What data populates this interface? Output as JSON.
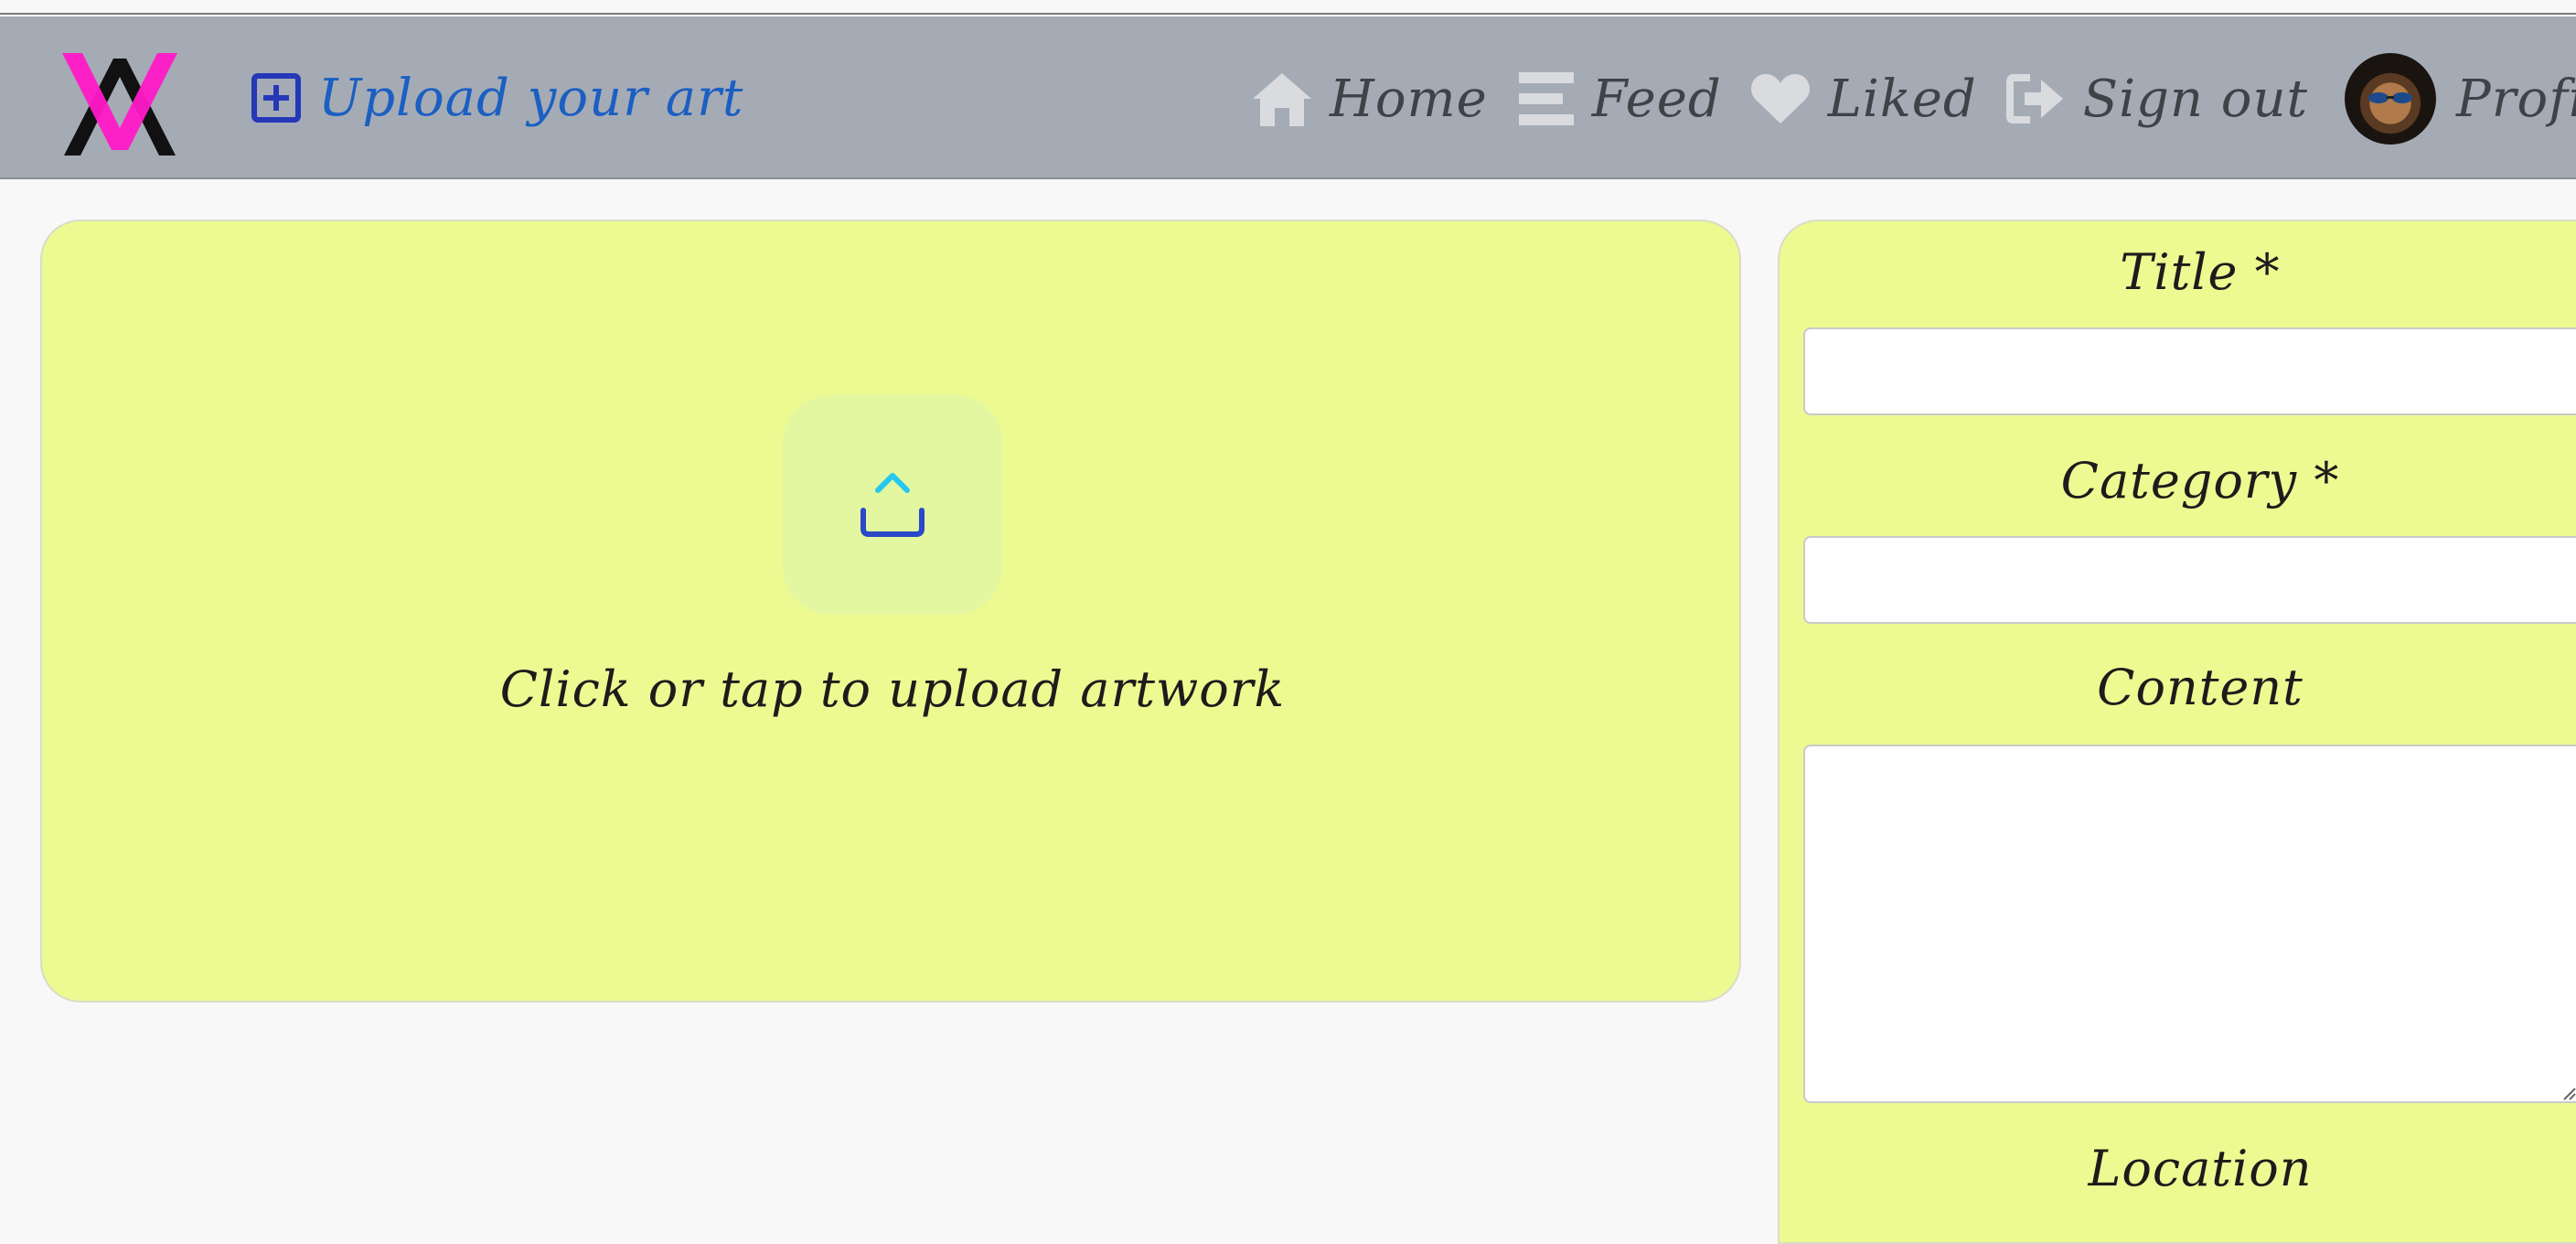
{
  "navbar": {
    "upload_label": "Upload your art",
    "items": [
      {
        "label": "Home",
        "icon": "home-icon"
      },
      {
        "label": "Feed",
        "icon": "bars-icon"
      },
      {
        "label": "Liked",
        "icon": "heart-icon"
      },
      {
        "label": "Sign out",
        "icon": "sign-out-icon"
      },
      {
        "label": "Profile",
        "icon": "avatar"
      }
    ]
  },
  "upload_area": {
    "prompt": "Click or tap to upload artwork",
    "icon": "upload-icon"
  },
  "form": {
    "title_label": "Title *",
    "title_value": "",
    "category_label": "Category *",
    "category_value": "",
    "content_label": "Content",
    "content_value": "",
    "location_label": "Location"
  },
  "colors": {
    "navbar_bg": "#a5abb5",
    "card_bg": "#edfa91",
    "upload_link": "#1b5fc2",
    "logo_magenta": "#ff19c8",
    "logo_black": "#111111",
    "nav_icon": "#d9dbdf"
  }
}
